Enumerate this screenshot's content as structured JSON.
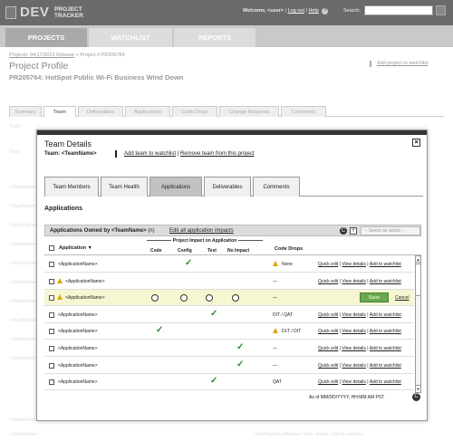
{
  "header": {
    "logo_dev": "DEV",
    "logo_line1": "PROJECT",
    "logo_line2": "TRACKER",
    "welcome": "Welcome, <user>",
    "logout": "Log out",
    "help": "Help",
    "help_icon": "?",
    "search_label": "Search:",
    "search_value": ""
  },
  "nav": {
    "projects": "PROJECTS",
    "watchlist": "WATCHLIST",
    "reports": "REPORTS"
  },
  "page": {
    "breadcrumb_link": "Projects: 04/17/2013 Release",
    "breadcrumb_rest": " > Project # PR205764",
    "title": "Project Profile",
    "subtitle": "PR205764: HotSpot Public Wi-Fi Business Wind Down",
    "add_watchlist": "Add project to watchlist",
    "tabs": [
      "Summary",
      "Team",
      "Deliverables",
      "Applications",
      "Code Drops",
      "Change Requests",
      "Comments"
    ]
  },
  "background_rows": [
    {
      "label": "Team",
      "right": ""
    },
    {
      "label": "Team",
      "right": ""
    },
    {
      "label": "<TeamName>",
      "right": ""
    },
    {
      "label": "<TeamName>",
      "right": ""
    },
    {
      "label": "<TeamName>",
      "right": ""
    },
    {
      "label": "<TeamName>",
      "right": ""
    },
    {
      "label": "<TeamName>",
      "right": ""
    },
    {
      "label": "<TeamName>",
      "right": ""
    },
    {
      "label": "<TeamName>",
      "right": ""
    },
    {
      "label": "<TeamName>",
      "right": ""
    },
    {
      "label": "<TeamName>",
      "right": ""
    },
    {
      "label": "<TeamName>",
      "right": ""
    },
    {
      "label": "<TeamName>",
      "right": ""
    },
    {
      "label": "<TeamName>",
      "right": "<FirstName/LastName>     Team details | Add to watchlist"
    }
  ],
  "modal": {
    "title": "Team Details",
    "team": "Team: <TeamName>",
    "flag_icon": "flag-icon",
    "add_watchlist": "Add team to watchlist",
    "separator": " | ",
    "remove_team": "Remove team from this project",
    "close_glyph": "×",
    "tabs": [
      "Team Members",
      "Team Health",
      "Applications",
      "Deliverables",
      "Comments"
    ],
    "active_tab": "Applications",
    "section_title": "Applications",
    "owned_label": "Applications Owned by <TeamName>",
    "owned_count": "(n)",
    "edit_impacts": "Edit all application impacts",
    "action_select": "-- Select an action --",
    "refresh_glyph": "C",
    "filter_glyph": "Y",
    "columns": {
      "application": "Application ▼",
      "impact_group": "Project Impact on Application",
      "code": "Code",
      "config": "Config",
      "test": "Test",
      "no_impact": "No Impact",
      "code_drops": "Code Drops"
    },
    "rows": [
      {
        "name": "<ApplicationName>",
        "warn": false,
        "impact": "config",
        "drop": "None",
        "drop_warn": true,
        "editing": false
      },
      {
        "name": "<ApplicationName>",
        "warn": true,
        "impact": "",
        "drop": "—",
        "drop_warn": false,
        "editing": false
      },
      {
        "name": "<ApplicationName>",
        "warn": true,
        "impact": "",
        "drop": "—",
        "drop_warn": false,
        "editing": true
      },
      {
        "name": "<ApplicationName>",
        "warn": false,
        "impact": "test",
        "drop": "DIT / QAT",
        "drop_warn": false,
        "editing": false
      },
      {
        "name": "<ApplicationName>",
        "warn": false,
        "impact": "code",
        "drop": "DLT / DIT",
        "drop_warn": true,
        "editing": false
      },
      {
        "name": "<ApplicationName>",
        "warn": false,
        "impact": "no_impact",
        "drop": "—",
        "drop_warn": false,
        "editing": false
      },
      {
        "name": "<ApplicationName>",
        "warn": false,
        "impact": "no_impact",
        "drop": "—",
        "drop_warn": false,
        "editing": false
      },
      {
        "name": "<ApplicationName>",
        "warn": false,
        "impact": "test",
        "drop": "QAT",
        "drop_warn": false,
        "editing": false
      }
    ],
    "row_actions": {
      "quick_edit": "Quick edit",
      "view_details": "View details",
      "add_watchlist": "Add to watchlist"
    },
    "save": "Save",
    "cancel": "Cancel",
    "check_glyph": "✓",
    "timestamp": "As of MM/DD/YYYY, HH:MM AM PST"
  },
  "colors": {
    "header_bg": "#6a6a6a",
    "nav_bg": "#c9c9c9",
    "check": "#2e8b2e",
    "warn": "#e0a800",
    "save": "#6aa84f",
    "selected_row": "#f6f6d2"
  }
}
